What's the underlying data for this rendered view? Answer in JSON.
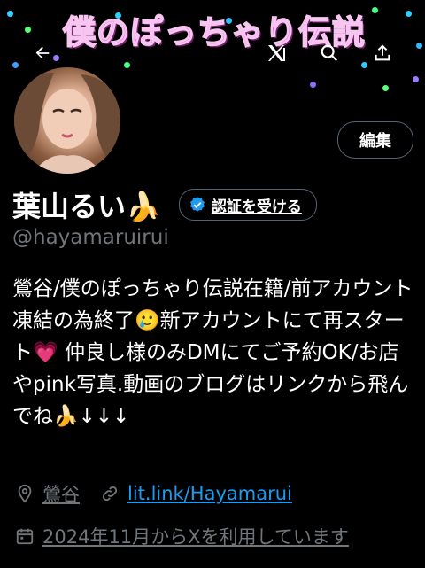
{
  "banner": {
    "title": "僕のぽっちゃり伝説"
  },
  "topbar": {
    "back_icon": "arrow-left-icon",
    "brand_icon": "x-logo-icon",
    "search_icon": "search-icon",
    "share_icon": "share-icon"
  },
  "profile": {
    "edit_label": "編集",
    "display_name": "葉山るい🍌",
    "verify_label": "認証を受ける",
    "handle": "@hayamaruirui",
    "bio": "鶯谷/僕のぽっちゃり伝説在籍/前アカウント凍結の為終了🥲新アカウントにて再スタート💗 仲良し様のみDMにてご予約OK/お店やpink写真.動画のブログはリンクから飛んでね🍌↓↓↓",
    "location": "鶯谷",
    "link": "lit.link/Hayamarui",
    "joined": "2024年11月からXを利用しています"
  },
  "colors": {
    "background": "#000000",
    "verified_blue": "#1d9bf0",
    "banner_pink": "#e45bd6"
  }
}
